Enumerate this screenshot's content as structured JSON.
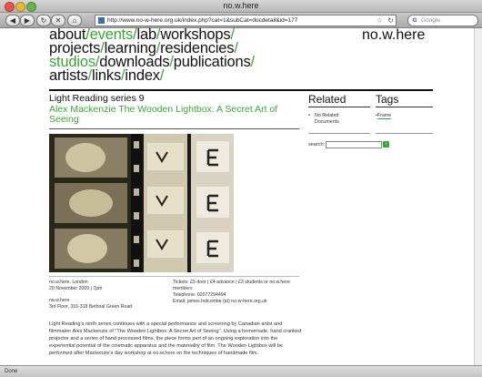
{
  "window": {
    "title": "no.w.here"
  },
  "toolbar": {
    "url": "http://www.no-w-here.org.uk/index.php?cat=1&subCat=docdetail&id=177",
    "search_placeholder": "Google"
  },
  "nav": {
    "rows": [
      [
        {
          "t": "about",
          "g": false
        },
        {
          "t": "/",
          "sep": true
        },
        {
          "t": "events",
          "g": true
        },
        {
          "t": "/",
          "sep": true
        },
        {
          "t": "lab",
          "g": false
        },
        {
          "t": "/",
          "sep": true
        },
        {
          "t": "workshops",
          "g": false
        },
        {
          "t": "/",
          "sep": true
        }
      ],
      [
        {
          "t": "projects",
          "g": false
        },
        {
          "t": "/",
          "sep": true
        },
        {
          "t": "learning",
          "g": false
        },
        {
          "t": "/",
          "sep": true
        },
        {
          "t": "residencies",
          "g": false
        },
        {
          "t": "/",
          "sep": true
        }
      ],
      [
        {
          "t": "studios",
          "g": true
        },
        {
          "t": "/",
          "sep": true
        },
        {
          "t": "downloads",
          "g": false
        },
        {
          "t": "/",
          "sep": true
        },
        {
          "t": "publications",
          "g": false
        },
        {
          "t": "/",
          "sep": true
        }
      ],
      [
        {
          "t": "artists",
          "g": false
        },
        {
          "t": "/",
          "sep": true
        },
        {
          "t": "links",
          "g": false
        },
        {
          "t": "/",
          "sep": true
        },
        {
          "t": "index",
          "g": false
        },
        {
          "t": "/",
          "sep": true
        }
      ]
    ]
  },
  "brand": "no.w.here",
  "main": {
    "series": "Light Reading series 9",
    "article_title": "Alex Mackenzie The Wooden Lightbox: A Secret Art of Seeing",
    "details": {
      "venue_line1": "no.w.here, London",
      "date": "20 November 2009 | 7pm",
      "venue_name": "no.w.here",
      "address": "3rd Floor, 316-318 Bethnal Green Road",
      "tickets": "Tickets: £5 door | £4 advance | £3 students or no.w.here",
      "tickets2": "members",
      "telephone": "Telephone: 02077294494",
      "email": "Email: james.holcombe (at) no-w-here.org.uk"
    },
    "body": "Light Reading's ninth series continues with a special performance and screening by Canadian artist and filmmaker Alex Mackenzie of \"The Wooden Lightbox: A Secret Art of Seeing\". Using a homemade, hand cranked projector and a series of hand processed films, the piece forms part of an ongoing exploration into the experiential potential of the cinematic apparatus and the materiality of film. The Wooden Lightbox will be performed after Mackenzie's day workshop at no.w.here on the techniques of handmade film."
  },
  "sidebar": {
    "related_heading": "Related",
    "related_items": [
      "No Related",
      "Documents"
    ],
    "tags_heading": "Tags",
    "tags": [
      "Frame"
    ],
    "search_label": "search:"
  },
  "status": "Done",
  "colors": {
    "accent": "#3aa734",
    "text": "#111111"
  }
}
